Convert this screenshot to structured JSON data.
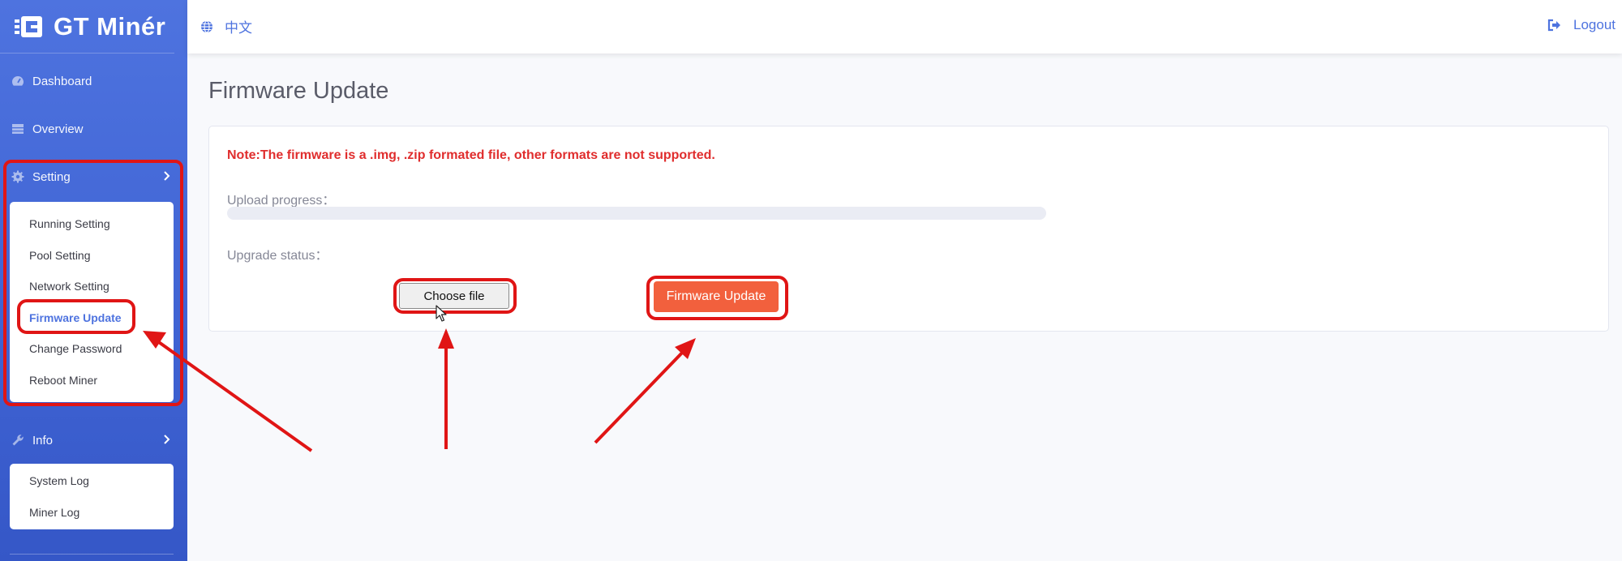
{
  "brand": {
    "name": "GT Minér"
  },
  "topbar": {
    "language": "中文",
    "logout": "Logout"
  },
  "sidebar": {
    "dashboard": "Dashboard",
    "overview": "Overview",
    "setting": {
      "label": "Setting",
      "items": [
        "Running Setting",
        "Pool Setting",
        "Network Setting",
        "Firmware Update",
        "Change Password",
        "Reboot Miner"
      ],
      "active": "Firmware Update"
    },
    "info": {
      "label": "Info",
      "items": [
        "System Log",
        "Miner Log"
      ]
    }
  },
  "page": {
    "title": "Firmware Update",
    "note": "Note:The firmware is a .img, .zip formated file, other formats are not supported.",
    "upload_progress_label": "Upload progress：",
    "upload_progress": 0,
    "upgrade_status_label": "Upgrade status：",
    "choose_file_button": "Choose file",
    "firmware_update_button": "Firmware Update"
  },
  "colors": {
    "sidebar": "#4e73df",
    "accent": "#4e73df",
    "note": "#e02d2d",
    "primary_button": "#f2603d",
    "annotation": "#e01515"
  },
  "icons": {
    "language": "globe-icon",
    "logout": "sign-out-icon",
    "dashboard": "tachometer-icon",
    "overview": "table-icon",
    "setting": "cog-icon",
    "info": "wrench-icon"
  }
}
